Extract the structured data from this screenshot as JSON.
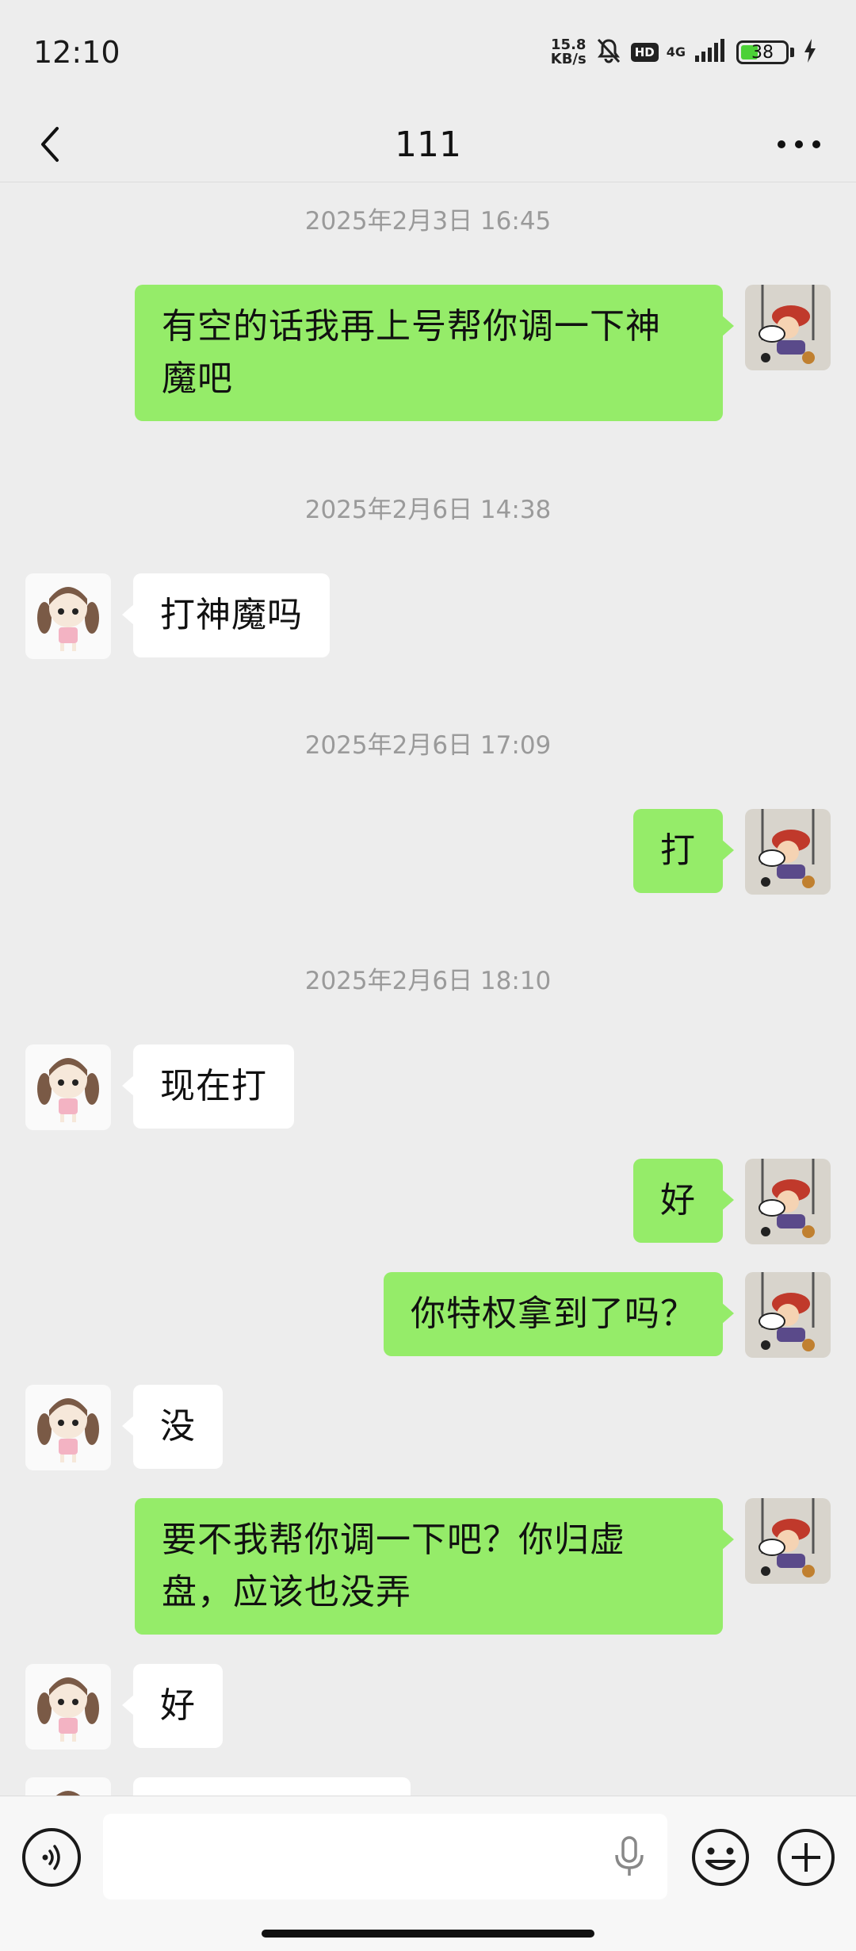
{
  "status_bar": {
    "time": "12:10",
    "net_speed_value": "15.8",
    "net_speed_unit": "KB/s",
    "hd": "HD",
    "network": "4G",
    "battery_level": "38"
  },
  "header": {
    "title": "111"
  },
  "colors": {
    "background": "#ededed",
    "outgoing_bubble": "#95ec69",
    "incoming_bubble": "#ffffff",
    "timestamp": "#9a9a9a"
  },
  "messages": [
    {
      "type": "timestamp",
      "text": "2025年2月3日 16:45"
    },
    {
      "type": "out",
      "text": "有空的话我再上号帮你调一下神魔吧"
    },
    {
      "type": "timestamp",
      "text": "2025年2月6日 14:38"
    },
    {
      "type": "in",
      "text": "打神魔吗"
    },
    {
      "type": "timestamp",
      "text": "2025年2月6日 17:09"
    },
    {
      "type": "out",
      "text": "打"
    },
    {
      "type": "timestamp",
      "text": "2025年2月6日 18:10"
    },
    {
      "type": "in",
      "text": "现在打"
    },
    {
      "type": "out",
      "text": "好"
    },
    {
      "type": "out",
      "text": "你特权拿到了吗？"
    },
    {
      "type": "in",
      "text": "没"
    },
    {
      "type": "out",
      "text": "要不我帮你调一下吧？你归虚盘，应该也没弄"
    },
    {
      "type": "in",
      "text": "好"
    }
  ],
  "input_bar": {
    "placeholder": "",
    "icons": [
      "voice-icon",
      "microphone-icon",
      "emoji-icon",
      "plus-icon"
    ]
  }
}
